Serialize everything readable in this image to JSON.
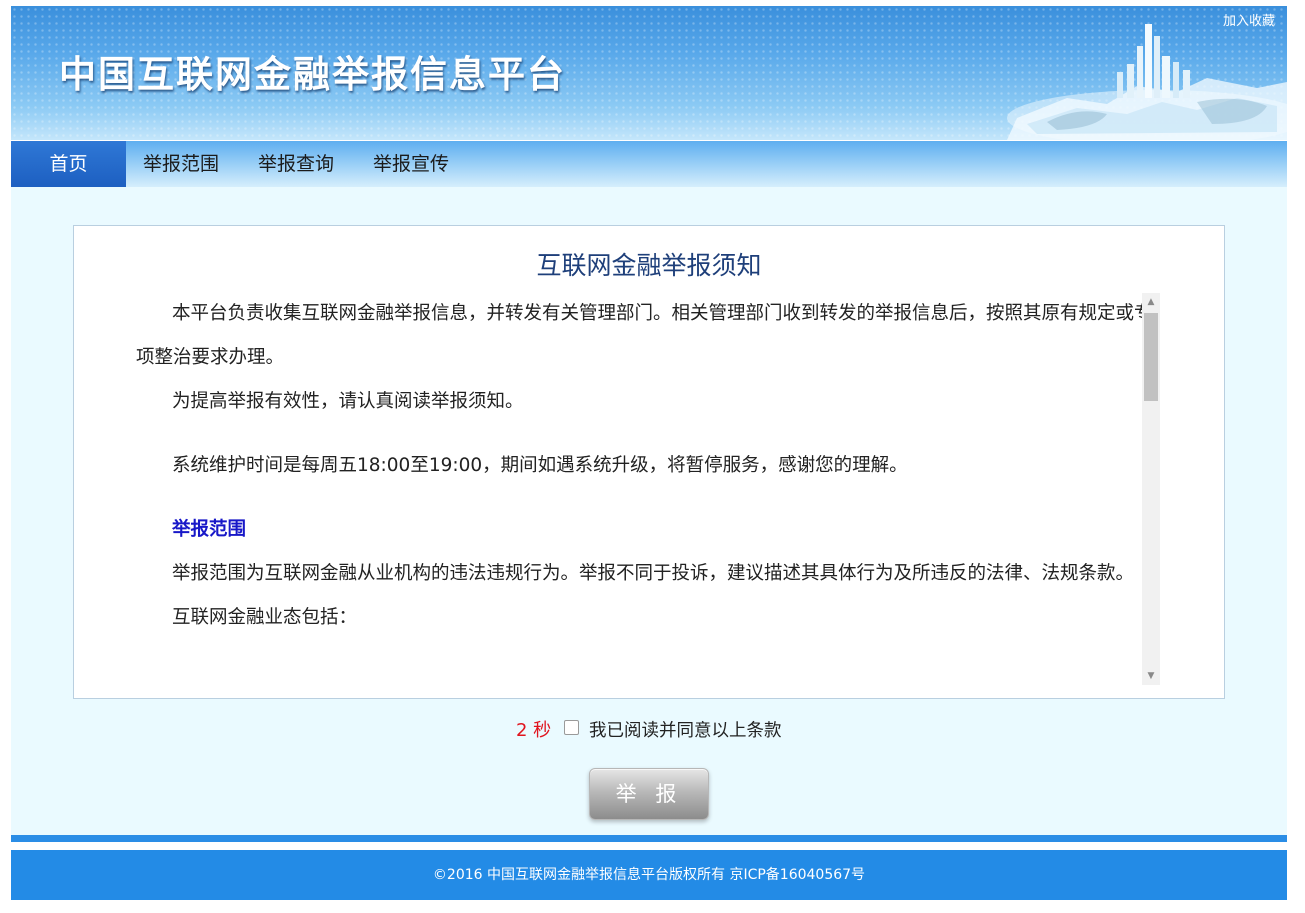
{
  "header": {
    "site_title": "中国互联网金融举报信息平台",
    "favorite_link": "加入收藏"
  },
  "nav": {
    "items": [
      {
        "label": "首页",
        "active": true
      },
      {
        "label": "举报范围",
        "active": false
      },
      {
        "label": "举报查询",
        "active": false
      },
      {
        "label": "举报宣传",
        "active": false
      }
    ]
  },
  "notice": {
    "title": "互联网金融举报须知",
    "paragraphs": [
      "本平台负责收集互联网金融举报信息，并转发有关管理部门。相关管理部门收到转发的举报信息后，按照其原有规定或专项整治要求办理。",
      "为提高举报有效性，请认真阅读举报须知。",
      "系统维护时间是每周五18:00至19:00，期间如遇系统升级，将暂停服务，感谢您的理解。",
      "举报范围",
      "举报范围为互联网金融从业机构的违法违规行为。举报不同于投诉，建议描述其具体行为及所违反的法律、法规条款。",
      "互联网金融业态包括："
    ]
  },
  "agreement": {
    "countdown": "2 秒",
    "checkbox_label": "我已阅读并同意以上条款",
    "checked": false
  },
  "submit_label": "举 报",
  "footer": {
    "copyright": "©2016 中国互联网金融举报信息平台版权所有 京ICP备16040567号"
  },
  "colors": {
    "banner_blue": "#3a8fdc",
    "nav_active": "#1d5fc1",
    "main_bg": "#eafaff",
    "notice_title": "#1e3f7a",
    "section_heading": "#1818c8",
    "countdown_red": "#e0141e",
    "footer_blue": "#238be6"
  }
}
